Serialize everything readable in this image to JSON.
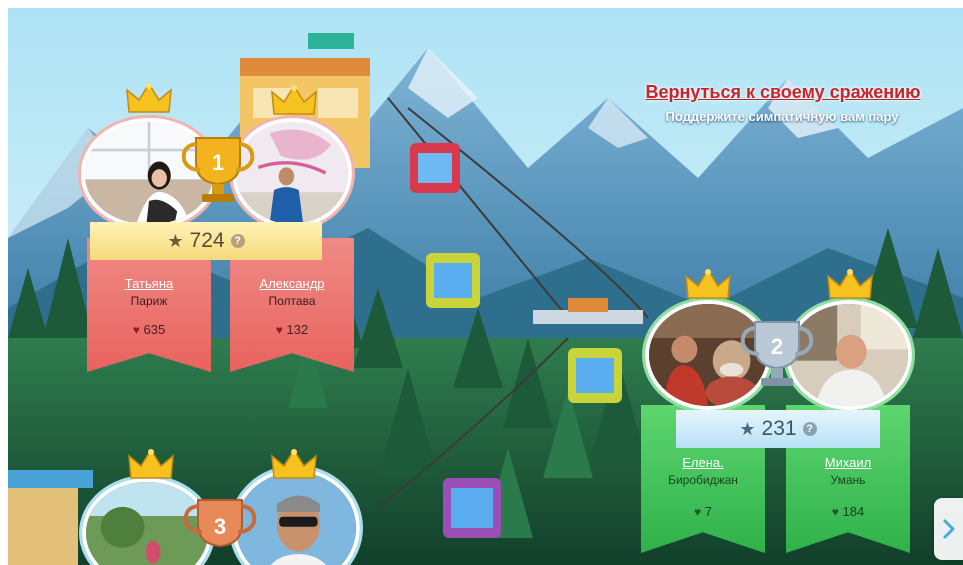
{
  "header": {
    "back_link": "Вернуться к своему сражению",
    "subtitle": "Поддержите симпатичную вам пару"
  },
  "pairs": [
    {
      "rank": "1",
      "score": "724",
      "theme": "gold",
      "left": {
        "name": "Татьяна",
        "city": "Париж",
        "likes": "635"
      },
      "right": {
        "name": "Александр",
        "city": "Полтава",
        "likes": "132"
      }
    },
    {
      "rank": "2",
      "score": "231",
      "theme": "silver",
      "left": {
        "name": "Елена.",
        "city": "Биробиджан",
        "likes": "7"
      },
      "right": {
        "name": "Михаил",
        "city": "Умань",
        "likes": "184"
      }
    },
    {
      "rank": "3",
      "theme": "bronze"
    }
  ],
  "icons": {
    "star": "★",
    "heart": "♥",
    "info": "?",
    "next": "chevron-right-icon",
    "crown": "crown-icon",
    "trophy": "trophy-icon"
  },
  "colors": {
    "link": "#c8252a",
    "red_banner": "#e9635f",
    "green_banner": "#2fb14a",
    "gold_ribbon": "#f6d97a",
    "blue_ribbon": "#b9e1f6"
  }
}
